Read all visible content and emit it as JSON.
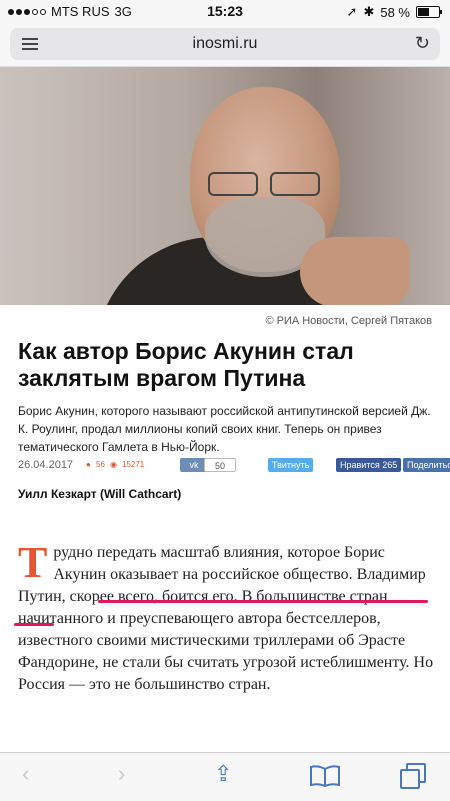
{
  "status_bar": {
    "carrier": "MTS RUS",
    "network": "3G",
    "time": "15:23",
    "battery": "58 %",
    "icons": [
      "location-arrow-icon",
      "bluetooth-icon",
      "battery-icon"
    ]
  },
  "browser": {
    "domain": "inosmi.ru",
    "icons": [
      "menu-icon",
      "reload-icon"
    ]
  },
  "photo": {
    "caption": "© РИА Новости, Сергей Пятаков"
  },
  "article": {
    "headline": "Как автор Борис Акунин стал заклятым врагом Путина",
    "lead": "Борис Акунин, которого называют российской антипутинской версией Дж. К. Роулинг, продал миллионы копий своих книг. Теперь он привез тематического Гамлета в Нью-Йорк.",
    "date": "26.04.2017",
    "comments_count": "56",
    "views_count": "15271",
    "vk_count": "50",
    "twitter_label": "Твитнуть",
    "facebook_label": "Нравится 265",
    "share_label": "Поделиться",
    "author": "Уилл Кезкарт (Will Cathcart)",
    "drop_cap": "Т",
    "body_text": "рудно передать масштаб влияния, которое Борис Акунин оказывает на российское общество. Владимир Путин, скорее всего, боится его. В большинстве стран начитанного и преуспевающего автора бестселлеров, известного своими мистическими триллерами об Эрасте Фандорине, не стали бы считать угрозой истеблишменту. Но Россия — это не большинство стран.",
    "accent_color": "#e8552e",
    "highlight_color": "#e3175f"
  },
  "toolbar": {
    "icons": [
      "back-icon",
      "forward-icon",
      "share-icon",
      "bookmarks-icon",
      "tabs-icon"
    ]
  }
}
